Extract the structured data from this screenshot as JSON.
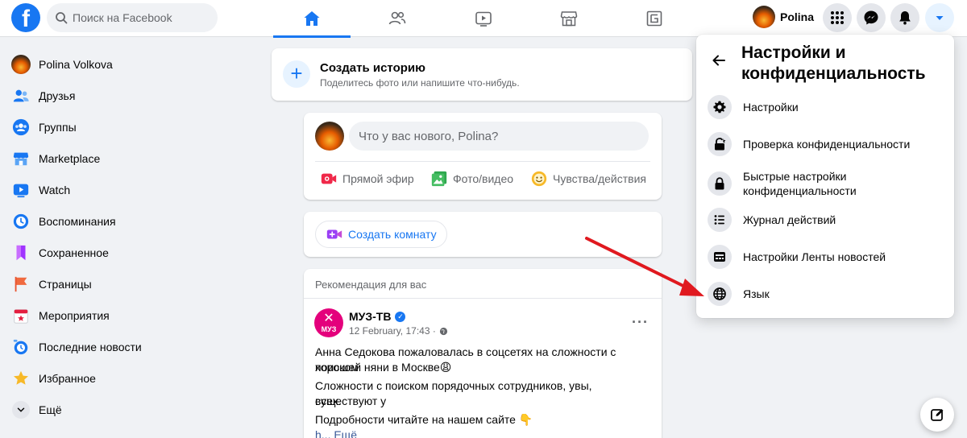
{
  "topbar": {
    "logo": "f",
    "search_placeholder": "Поиск на Facebook",
    "profile_name": "Polina"
  },
  "sidebar": {
    "items": [
      {
        "label": "Polina Volkova"
      },
      {
        "label": "Друзья"
      },
      {
        "label": "Группы"
      },
      {
        "label": "Marketplace"
      },
      {
        "label": "Watch"
      },
      {
        "label": "Воспоминания"
      },
      {
        "label": "Сохраненное"
      },
      {
        "label": "Страницы"
      },
      {
        "label": "Мероприятия"
      },
      {
        "label": "Последние новости"
      },
      {
        "label": "Избранное"
      },
      {
        "label": "Ещё"
      }
    ]
  },
  "story": {
    "title": "Создать историю",
    "subtitle": "Поделитесь фото или напишите что-нибудь."
  },
  "composer": {
    "placeholder": "Что у вас нового, Polina?",
    "actions": [
      "Прямой эфир",
      "Фото/видео",
      "Чувства/действия"
    ]
  },
  "room": {
    "label": "Создать комнату"
  },
  "recommendation": {
    "header": "Рекомендация для вас",
    "logo_text": "МУЗ",
    "page_name": "МУЗ-ТВ",
    "time": "12 February, 17:43 ·",
    "more": "···",
    "text_1a": "Анна Седокова пожаловалась в соцсетях на сложности с поиском",
    "text_1b": "хорошей няни в Москве😩",
    "text_2a": "Сложности с поиском порядочных сотрудников, увы, существуют у",
    "text_2b": "всех.",
    "text_3": "Подробности читайте на нашем сайте 👇",
    "text_4": "h... Ещё"
  },
  "menu": {
    "title": "Настройки и конфиденциальность",
    "items": [
      {
        "label": "Настройки",
        "icon": "gear-icon"
      },
      {
        "label": "Проверка конфиденциальности",
        "icon": "lock-check-icon"
      },
      {
        "label": "Быстрые настройки конфиденциальности",
        "icon": "lock-icon"
      },
      {
        "label": "Журнал действий",
        "icon": "list-icon"
      },
      {
        "label": "Настройки Ленты новостей",
        "icon": "feed-icon"
      },
      {
        "label": "Язык",
        "icon": "globe-icon"
      }
    ]
  },
  "colors": {
    "brand": "#1877f2",
    "arrow": "#e0191f"
  }
}
